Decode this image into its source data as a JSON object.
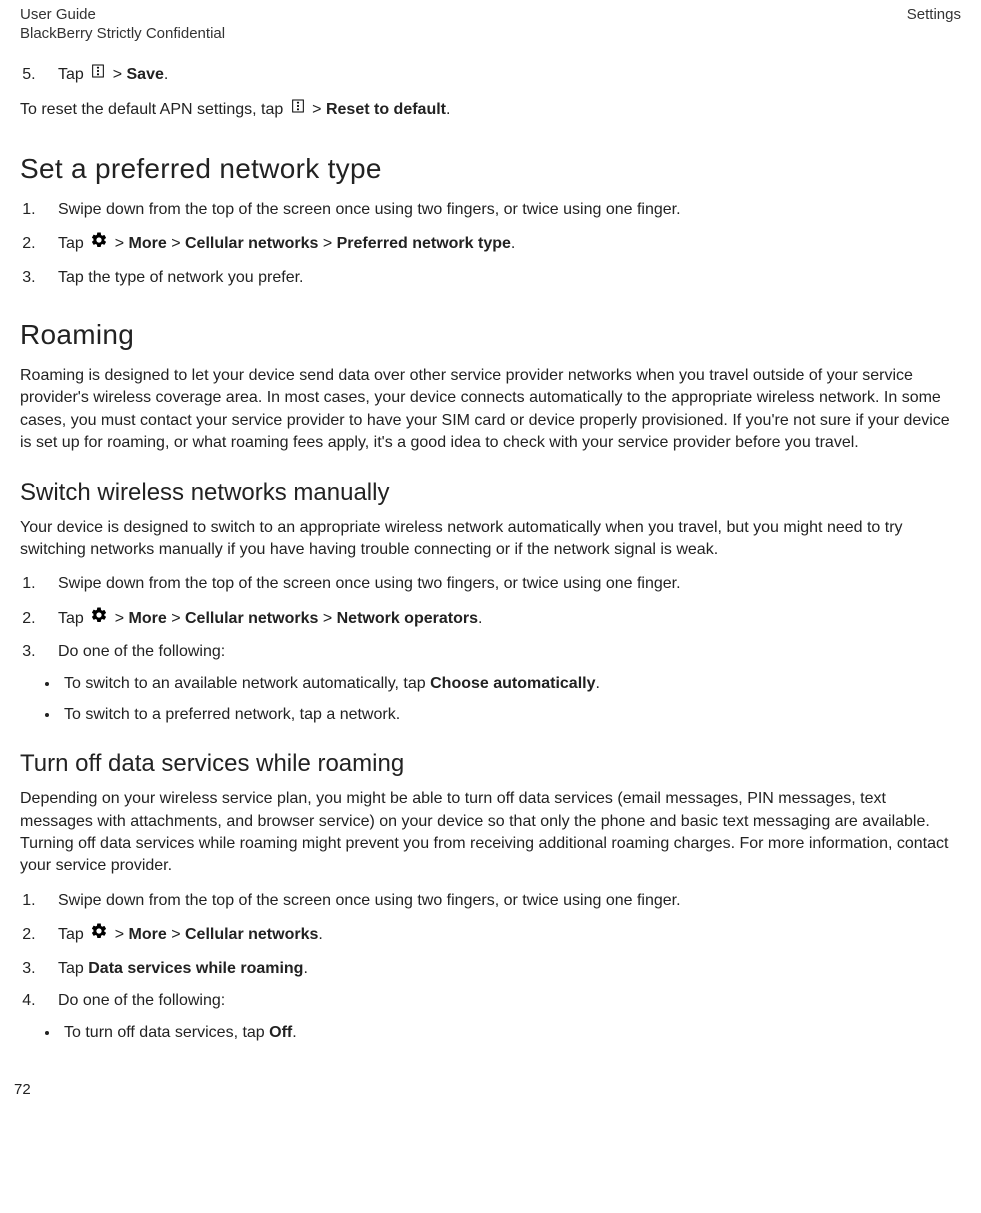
{
  "header": {
    "left1": "User Guide",
    "right": "Settings",
    "left2": "BlackBerry Strictly Confidential"
  },
  "step5": {
    "pre": "Tap ",
    "post_gt": " > ",
    "bold": "Save",
    "period": "."
  },
  "reset": {
    "pre": "To reset the default APN settings, tap ",
    "post_gt": " > ",
    "bold": "Reset to default",
    "period": "."
  },
  "sec_preferred": {
    "title": "Set a preferred network type",
    "step1": "Swipe down from the top of the screen once using two fingers, or twice using one finger.",
    "step2_pre": "Tap ",
    "step2_gt1": " > ",
    "step2_b1": "More",
    "step2_gt2": " > ",
    "step2_b2": "Cellular networks",
    "step2_gt3": " > ",
    "step2_b3": "Preferred network type",
    "step2_period": ".",
    "step3": "Tap the type of network you prefer."
  },
  "sec_roaming": {
    "title": "Roaming",
    "para": "Roaming is designed to let your device send data over other service provider networks when you travel outside of your service provider's wireless coverage area. In most cases, your device connects automatically to the appropriate wireless network. In some cases, you must contact your service provider to have your SIM card or device properly provisioned. If you're not sure if your device is set up for roaming, or what roaming fees apply, it's a good idea to check with your service provider before you travel."
  },
  "sec_switch": {
    "title": "Switch wireless networks manually",
    "para": "Your device is designed to switch to an appropriate wireless network automatically when you travel, but you might need to try switching networks manually if you have having trouble connecting or if the network signal is weak.",
    "step1": "Swipe down from the top of the screen once using two fingers, or twice using one finger.",
    "step2_pre": "Tap ",
    "step2_gt1": " > ",
    "step2_b1": "More",
    "step2_gt2": " > ",
    "step2_b2": "Cellular networks",
    "step2_gt3": " > ",
    "step2_b3": "Network operators",
    "step2_period": ".",
    "step3": "Do one of the following:",
    "bullet1_pre": "To switch to an available network automatically, tap ",
    "bullet1_bold": "Choose automatically",
    "bullet1_period": ".",
    "bullet2": "To switch to a preferred network, tap a network."
  },
  "sec_turnoff": {
    "title": "Turn off data services while roaming",
    "para": "Depending on your wireless service plan, you might be able to turn off data services (email messages, PIN messages, text messages with attachments, and browser service) on your device so that only the phone and basic text messaging are available. Turning off data services while roaming might prevent you from receiving additional roaming charges. For more information, contact your service provider.",
    "step1": "Swipe down from the top of the screen once using two fingers, or twice using one finger.",
    "step2_pre": "Tap ",
    "step2_gt1": " > ",
    "step2_b1": "More",
    "step2_gt2": " > ",
    "step2_b2": "Cellular networks",
    "step2_period": ".",
    "step3_pre": "Tap ",
    "step3_bold": "Data services while roaming",
    "step3_period": ".",
    "step4": "Do one of the following:",
    "bullet1_pre": "To turn off data services, tap ",
    "bullet1_bold": "Off",
    "bullet1_period": "."
  },
  "page_number": "72"
}
